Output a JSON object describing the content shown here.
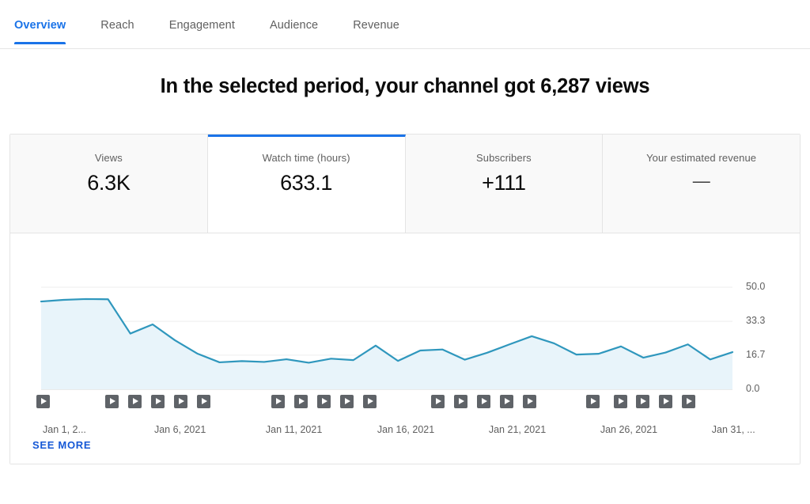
{
  "tabs": [
    {
      "label": "Overview",
      "active": true
    },
    {
      "label": "Reach",
      "active": false
    },
    {
      "label": "Engagement",
      "active": false
    },
    {
      "label": "Audience",
      "active": false
    },
    {
      "label": "Revenue",
      "active": false
    }
  ],
  "headline": "In the selected period, your channel got 6,287 views",
  "metrics": [
    {
      "label": "Views",
      "value": "6.3K",
      "selected": false
    },
    {
      "label": "Watch time (hours)",
      "value": "633.1",
      "selected": true
    },
    {
      "label": "Subscribers",
      "value": "+111",
      "selected": false
    },
    {
      "label": "Your estimated revenue",
      "value": "—",
      "selected": false
    }
  ],
  "footer": {
    "see_more_label": "SEE MORE"
  },
  "colors": {
    "accent_blue": "#1a73e8",
    "link_blue": "#1558d6",
    "line_teal": "#2f97bd",
    "area_fill": "#e8f4fa",
    "marker_grey": "#5f6368",
    "grid_grey": "#ededed",
    "text_secondary": "#606060"
  },
  "chart_data": {
    "type": "area",
    "title": "Watch time (hours)",
    "xlabel": "",
    "ylabel": "",
    "ylim": [
      0,
      50
    ],
    "grid": true,
    "legend": "none",
    "ytick_labels": [
      "50.0",
      "33.3",
      "16.7",
      "0.0"
    ],
    "ytick_values": [
      50.0,
      33.3,
      16.7,
      0.0
    ],
    "xtick_labels": [
      "Jan 1, 2...",
      "Jan 6, 2021",
      "Jan 11, 2021",
      "Jan 16, 2021",
      "Jan 21, 2021",
      "Jan 26, 2021",
      "Jan 31, ..."
    ],
    "xtick_indices": [
      0,
      5,
      10,
      15,
      20,
      25,
      30
    ],
    "x": [
      "Jan 1, 2021",
      "Jan 2, 2021",
      "Jan 3, 2021",
      "Jan 4, 2021",
      "Jan 5, 2021",
      "Jan 6, 2021",
      "Jan 7, 2021",
      "Jan 8, 2021",
      "Jan 9, 2021",
      "Jan 10, 2021",
      "Jan 11, 2021",
      "Jan 12, 2021",
      "Jan 13, 2021",
      "Jan 14, 2021",
      "Jan 15, 2021",
      "Jan 16, 2021",
      "Jan 17, 2021",
      "Jan 18, 2021",
      "Jan 19, 2021",
      "Jan 20, 2021",
      "Jan 21, 2021",
      "Jan 22, 2021",
      "Jan 23, 2021",
      "Jan 24, 2021",
      "Jan 25, 2021",
      "Jan 26, 2021",
      "Jan 27, 2021",
      "Jan 28, 2021",
      "Jan 29, 2021",
      "Jan 30, 2021",
      "Jan 31, 2021"
    ],
    "values": [
      43.0,
      43.8,
      44.2,
      44.1,
      27.3,
      31.8,
      24.0,
      17.5,
      13.2,
      13.8,
      13.4,
      14.7,
      13.0,
      15.0,
      14.3,
      21.4,
      13.9,
      19.0,
      19.5,
      14.5,
      17.9,
      22.0,
      26.0,
      22.5,
      17.0,
      17.4,
      21.0,
      15.5,
      18.0,
      22.0,
      14.6,
      18.2
    ],
    "video_markers": [
      33,
      120,
      149,
      178,
      207,
      236,
      330,
      359,
      388,
      417,
      446,
      532,
      561,
      590,
      619,
      648,
      728,
      763,
      791,
      820,
      849
    ]
  }
}
